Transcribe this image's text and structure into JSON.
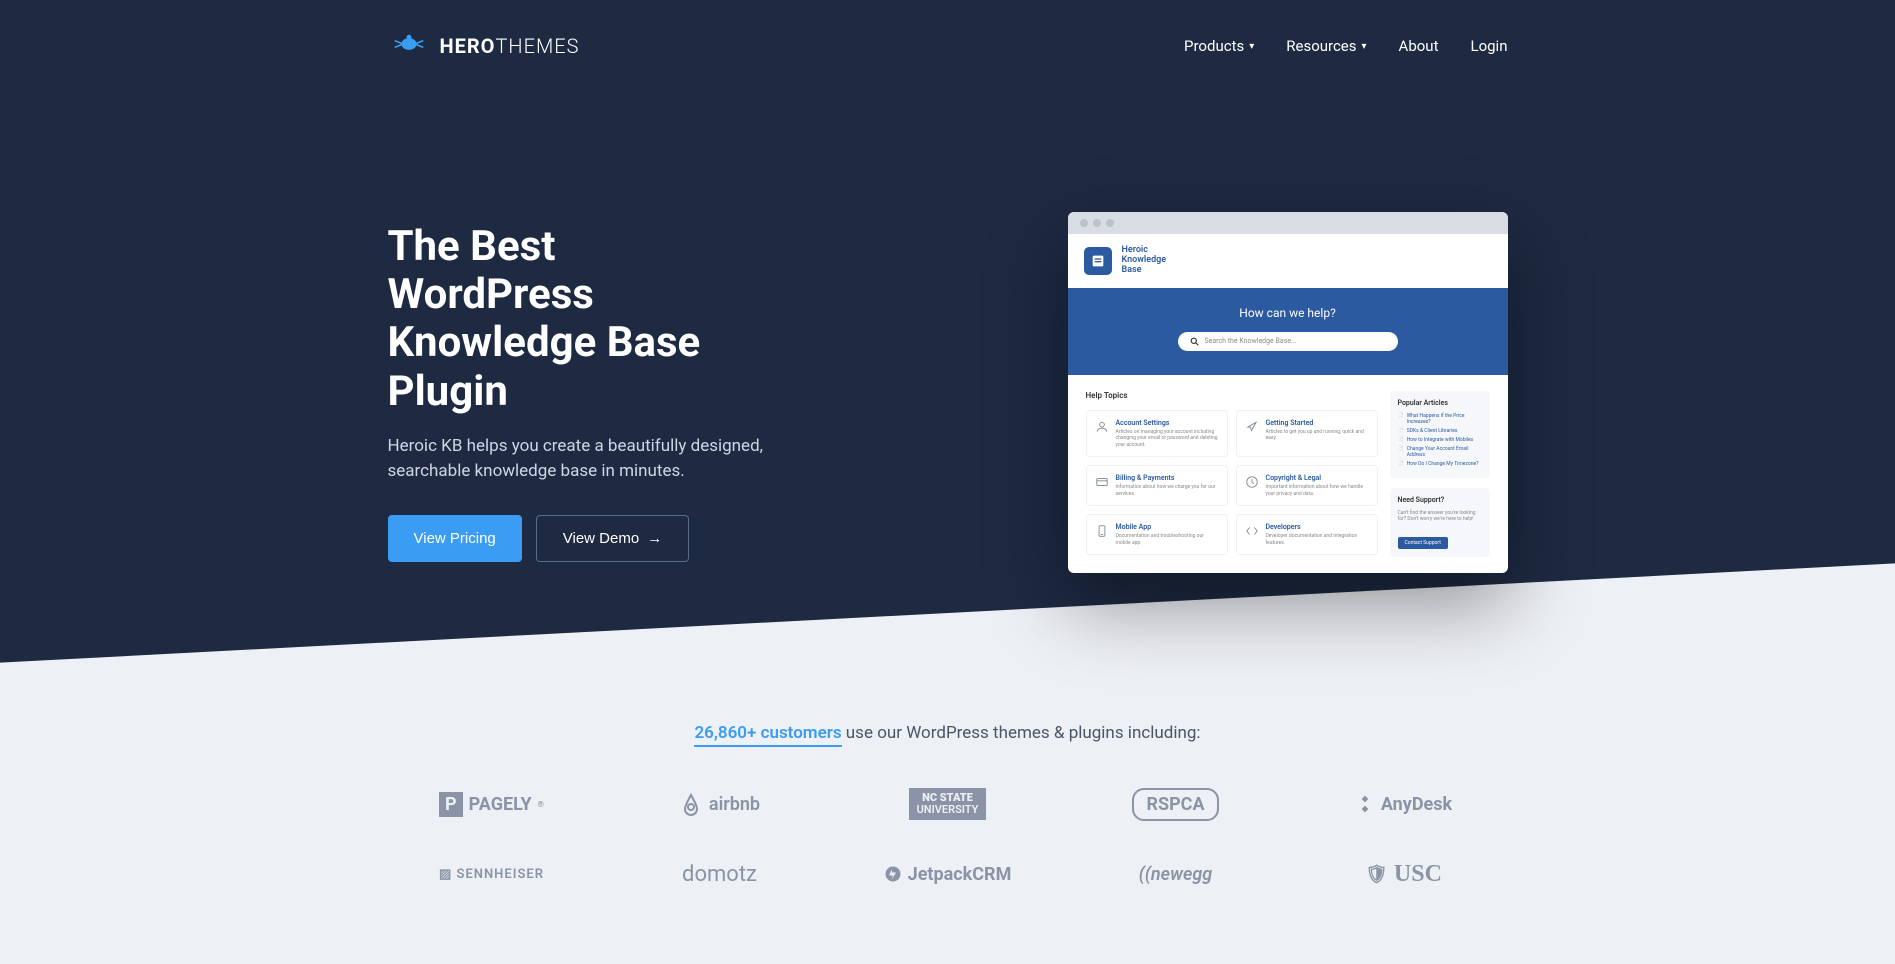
{
  "nav": {
    "logo_first": "HERO",
    "logo_second": "THEMES",
    "items": [
      "Products",
      "Resources",
      "About",
      "Login"
    ]
  },
  "hero": {
    "title": "The Best WordPress Knowledge Base Plugin",
    "subtitle": "Heroic KB helps you create a beautifully designed, searchable knowledge base in minutes.",
    "btn_primary": "View Pricing",
    "btn_secondary": "View Demo"
  },
  "mockup": {
    "brand": "Heroic\nKnowledge\nBase",
    "search_title": "How can we help?",
    "search_placeholder": "Search the Knowledge Base...",
    "topics_title": "Help Topics",
    "topics": [
      {
        "title": "Account Settings",
        "desc": "Articles on managing your account including changing your email or password and deleting your account."
      },
      {
        "title": "Getting Started",
        "desc": "Articles to get you up and running, quick and easy."
      },
      {
        "title": "Billing & Payments",
        "desc": "Information about how we charge you for our services."
      },
      {
        "title": "Copyright & Legal",
        "desc": "Important information about how we handle your privacy and data."
      },
      {
        "title": "Mobile App",
        "desc": "Documentation and troubleshooting our mobile app."
      },
      {
        "title": "Developers",
        "desc": "Developer documentation and integration features."
      }
    ],
    "popular_title": "Popular Articles",
    "popular": [
      "What Happens if the Price Increases?",
      "SDKs & Client Libraries",
      "How to Integrate with Mobiles",
      "Change Your Account Email Address",
      "How Do I Change My Timezone?"
    ],
    "support_title": "Need Support?",
    "support_desc": "Can't find the answer you're looking for? Don't worry we're here to help!",
    "support_btn": "Contact Support"
  },
  "customers": {
    "count": "26,860+ customers",
    "rest": " use our WordPress themes & plugins including:",
    "logos": [
      "PAGELY",
      "airbnb",
      "NC STATE UNIVERSITY",
      "RSPCA",
      "AnyDesk",
      "SENNHEISER",
      "domotz",
      "JetpackCRM",
      "newegg",
      "USC"
    ]
  }
}
